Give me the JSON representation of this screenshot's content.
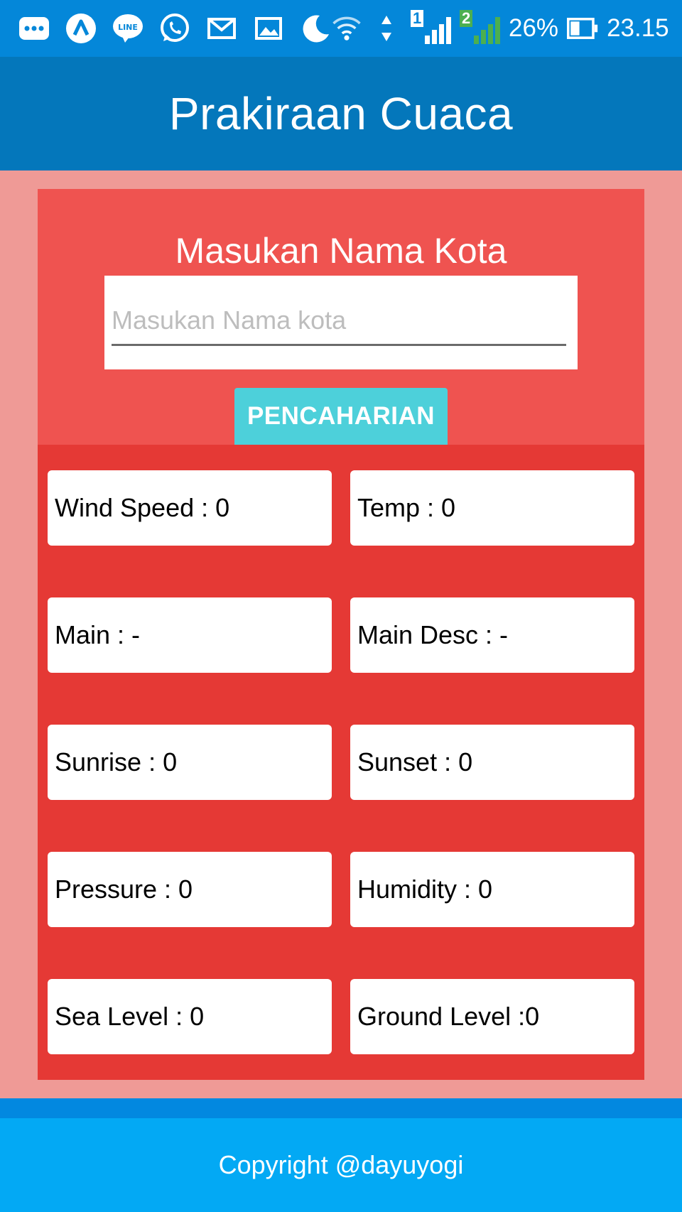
{
  "status_bar": {
    "icons": [
      "more-icon",
      "app-icon",
      "line-icon",
      "whatsapp-icon",
      "mail-icon",
      "gallery-icon",
      "moon-icon",
      "wifi-icon"
    ],
    "sim1_label": "1",
    "sim2_label": "2",
    "battery": "26%",
    "time": "23.15"
  },
  "app_bar": {
    "title": "Prakiraan Cuaca"
  },
  "search": {
    "title": "Masukan Nama Kota",
    "placeholder": "Masukan Nama kota",
    "value": "",
    "button_label": "PENCAHARIAN"
  },
  "weather": {
    "wind_speed": "Wind Speed : 0",
    "temp": "Temp : 0",
    "main": "Main : -",
    "main_desc": "Main Desc : -",
    "sunrise": "Sunrise : 0",
    "sunset": "Sunset : 0",
    "pressure": "Pressure : 0",
    "humidity": "Humidity : 0",
    "sea_level": "Sea Level : 0",
    "ground_level": "Ground Level :0"
  },
  "footer": {
    "copyright": "Copyright @dayuyogi"
  },
  "colors": {
    "status_bar": "#0487d9",
    "app_bar": "#0477bb",
    "background": "#ef9a96",
    "search_card": "#ef5350",
    "grid_panel": "#e53935",
    "button": "#4dd0da",
    "footer": "#03a9f4"
  }
}
